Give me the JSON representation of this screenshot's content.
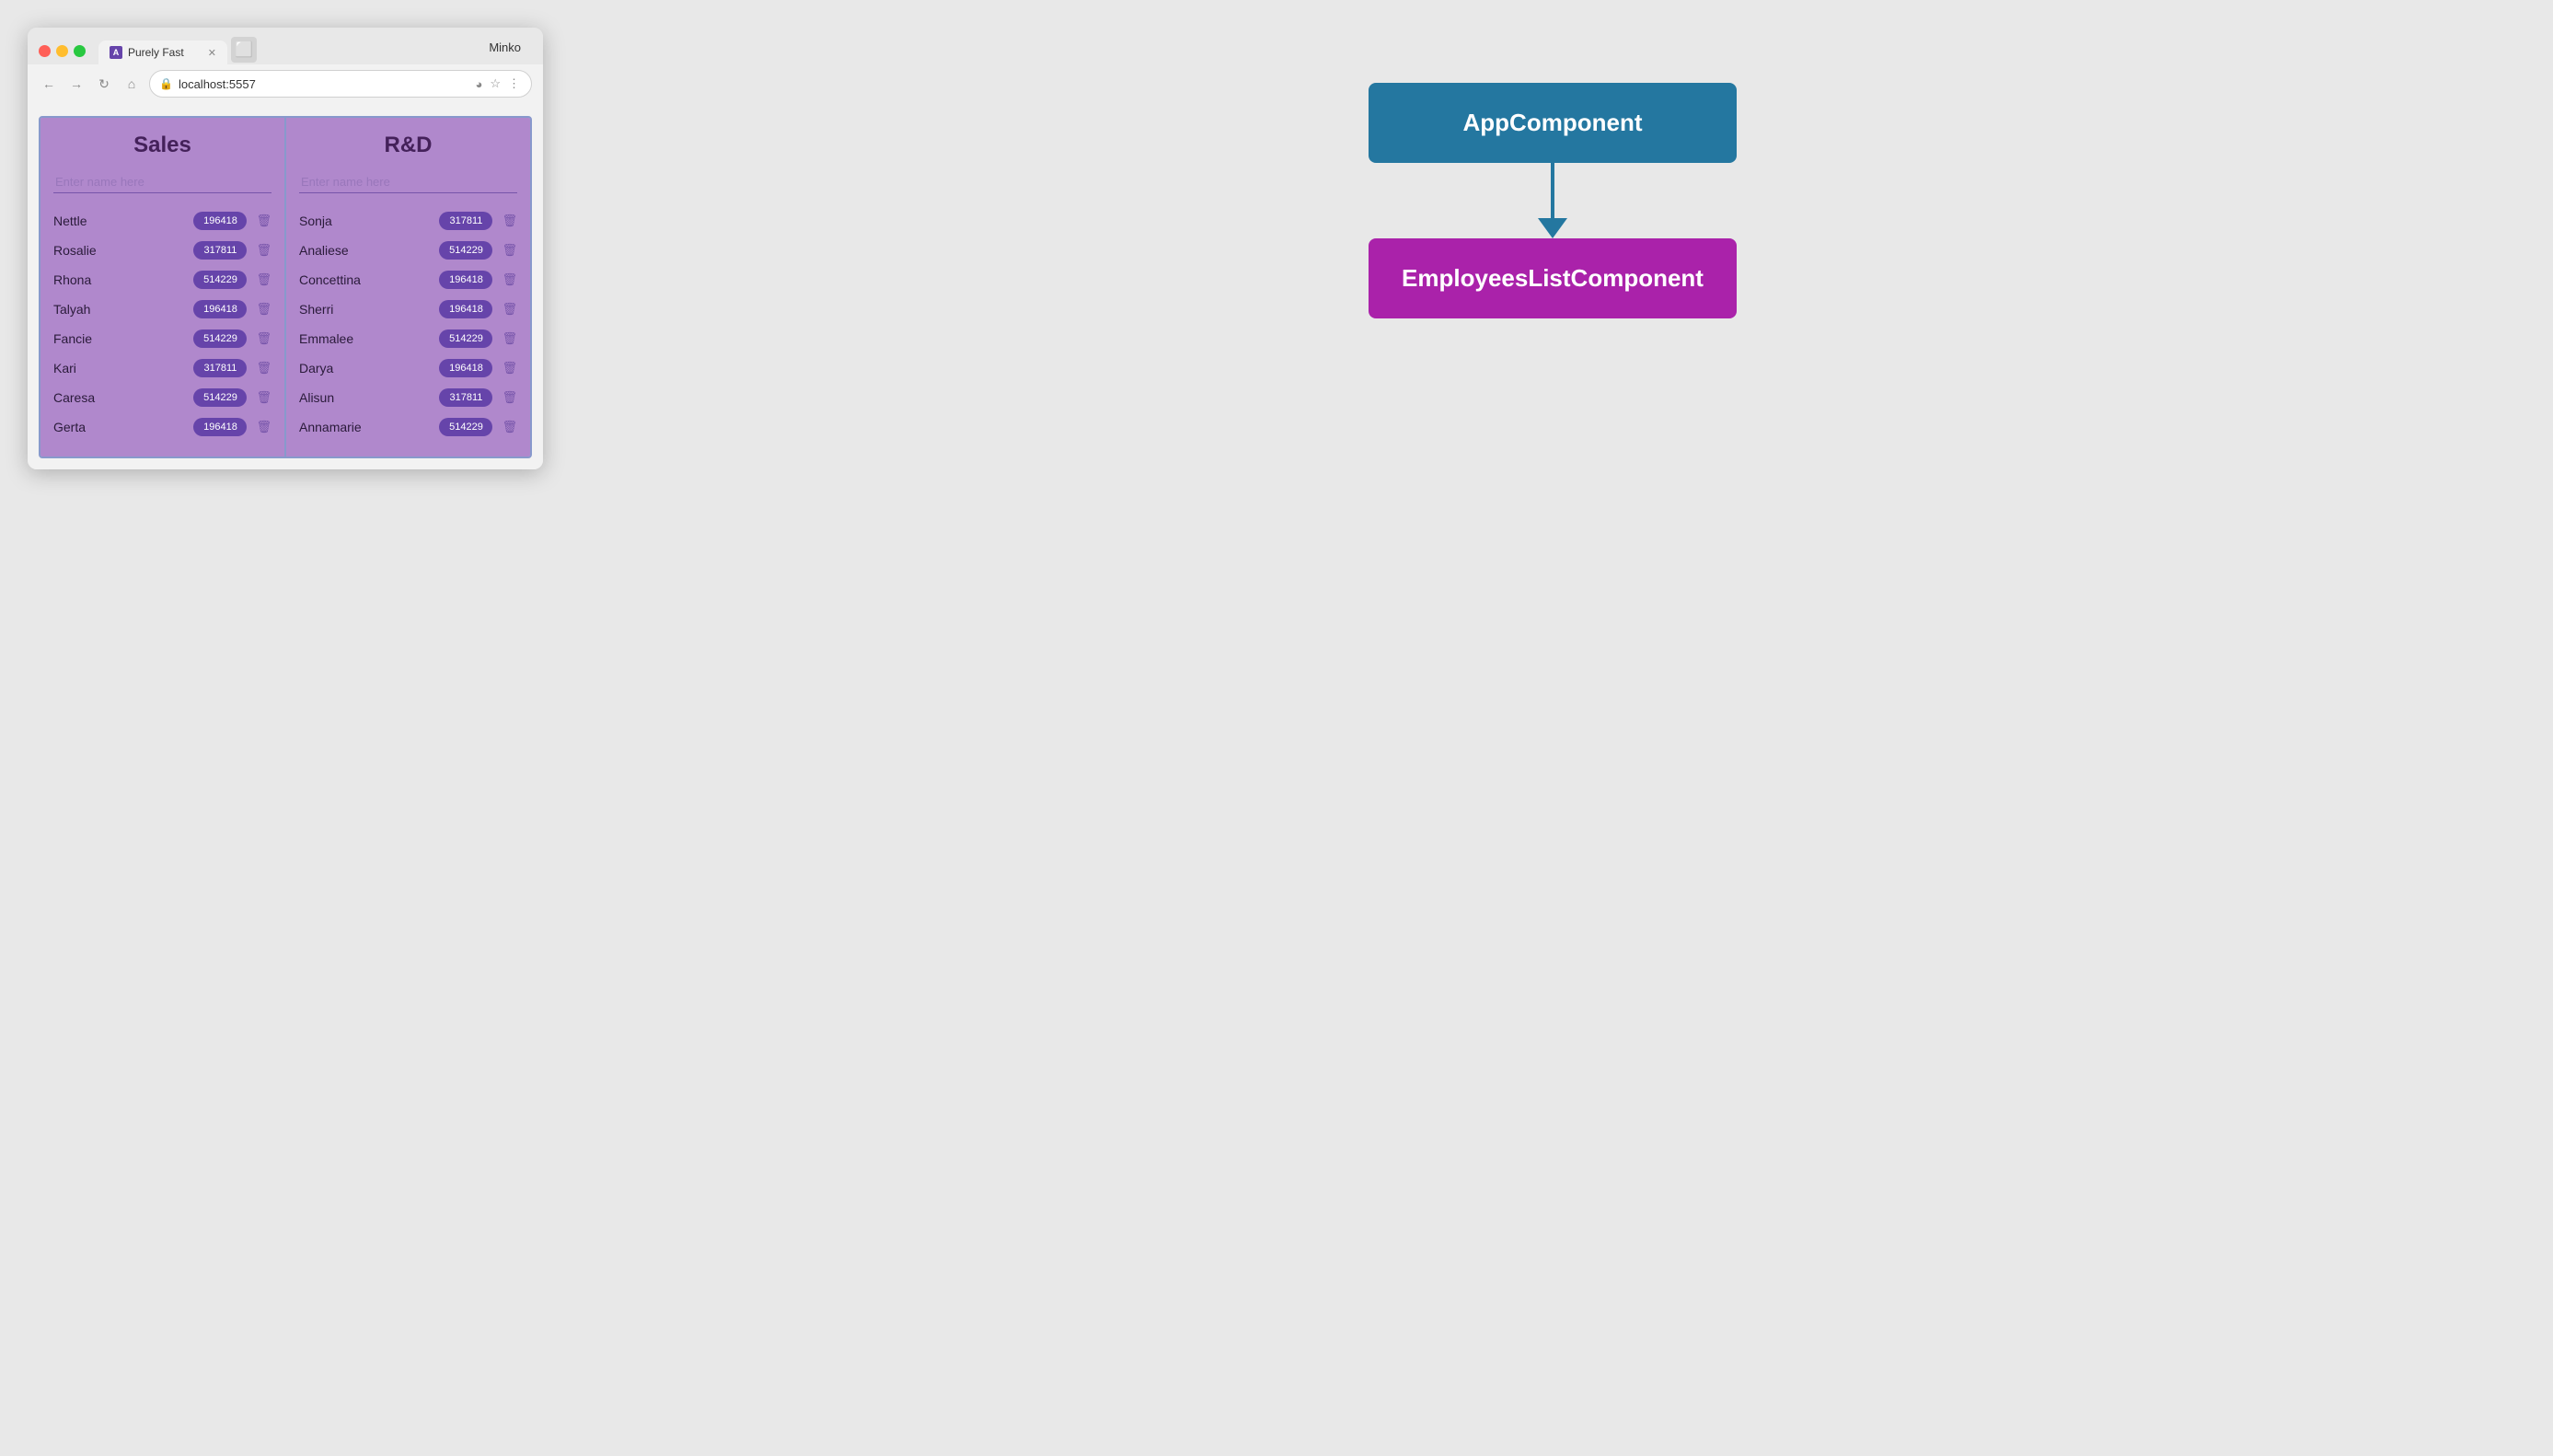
{
  "browser": {
    "tab_title": "Purely Fast",
    "tab_favicon": "A",
    "url": "localhost:5557",
    "user": "Minko",
    "new_tab_icon": "⬜"
  },
  "app": {
    "sales": {
      "title": "Sales",
      "input_placeholder": "Enter name here",
      "employees": [
        {
          "name": "Nettle",
          "badge": "196418"
        },
        {
          "name": "Rosalie",
          "badge": "317811"
        },
        {
          "name": "Rhona",
          "badge": "514229"
        },
        {
          "name": "Talyah",
          "badge": "196418"
        },
        {
          "name": "Fancie",
          "badge": "514229"
        },
        {
          "name": "Kari",
          "badge": "317811"
        },
        {
          "name": "Caresa",
          "badge": "514229"
        },
        {
          "name": "Gerta",
          "badge": "196418"
        }
      ]
    },
    "rnd": {
      "title": "R&D",
      "input_placeholder": "Enter name here",
      "employees": [
        {
          "name": "Sonja",
          "badge": "317811"
        },
        {
          "name": "Analiese",
          "badge": "514229"
        },
        {
          "name": "Concettina",
          "badge": "196418"
        },
        {
          "name": "Sherri",
          "badge": "196418"
        },
        {
          "name": "Emmalee",
          "badge": "514229"
        },
        {
          "name": "Darya",
          "badge": "196418"
        },
        {
          "name": "Alisun",
          "badge": "317811"
        },
        {
          "name": "Annamarie",
          "badge": "514229"
        }
      ]
    }
  },
  "diagram": {
    "app_component_label": "AppComponent",
    "employees_component_label": "EmployeesListComponent",
    "arrow_color": "#2477a0"
  }
}
